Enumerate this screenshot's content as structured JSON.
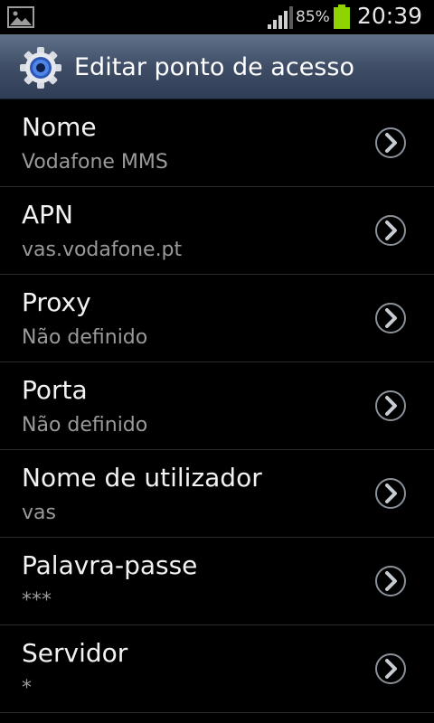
{
  "status_bar": {
    "notification_icon": "image-icon",
    "signal_icon": "signal-icon",
    "battery_percent": "85%",
    "battery_icon": "battery-icon",
    "time": "20:39"
  },
  "header": {
    "icon": "gear-icon",
    "title": "Editar ponto de acesso"
  },
  "settings": [
    {
      "label": "Nome",
      "value": "Vodafone MMS"
    },
    {
      "label": "APN",
      "value": "vas.vodafone.pt"
    },
    {
      "label": "Proxy",
      "value": "Não definido"
    },
    {
      "label": "Porta",
      "value": "Não definido"
    },
    {
      "label": "Nome de utilizador",
      "value": "vas"
    },
    {
      "label": "Palavra-passe",
      "value": "***"
    },
    {
      "label": "Servidor",
      "value": "*"
    }
  ],
  "colors": {
    "background": "#000000",
    "title_bar": "#3f4e66",
    "battery_fill": "#8fd400",
    "primary_text": "#f2f2f2",
    "secondary_text": "#9a9a9a",
    "divider": "#2c2c2c"
  }
}
